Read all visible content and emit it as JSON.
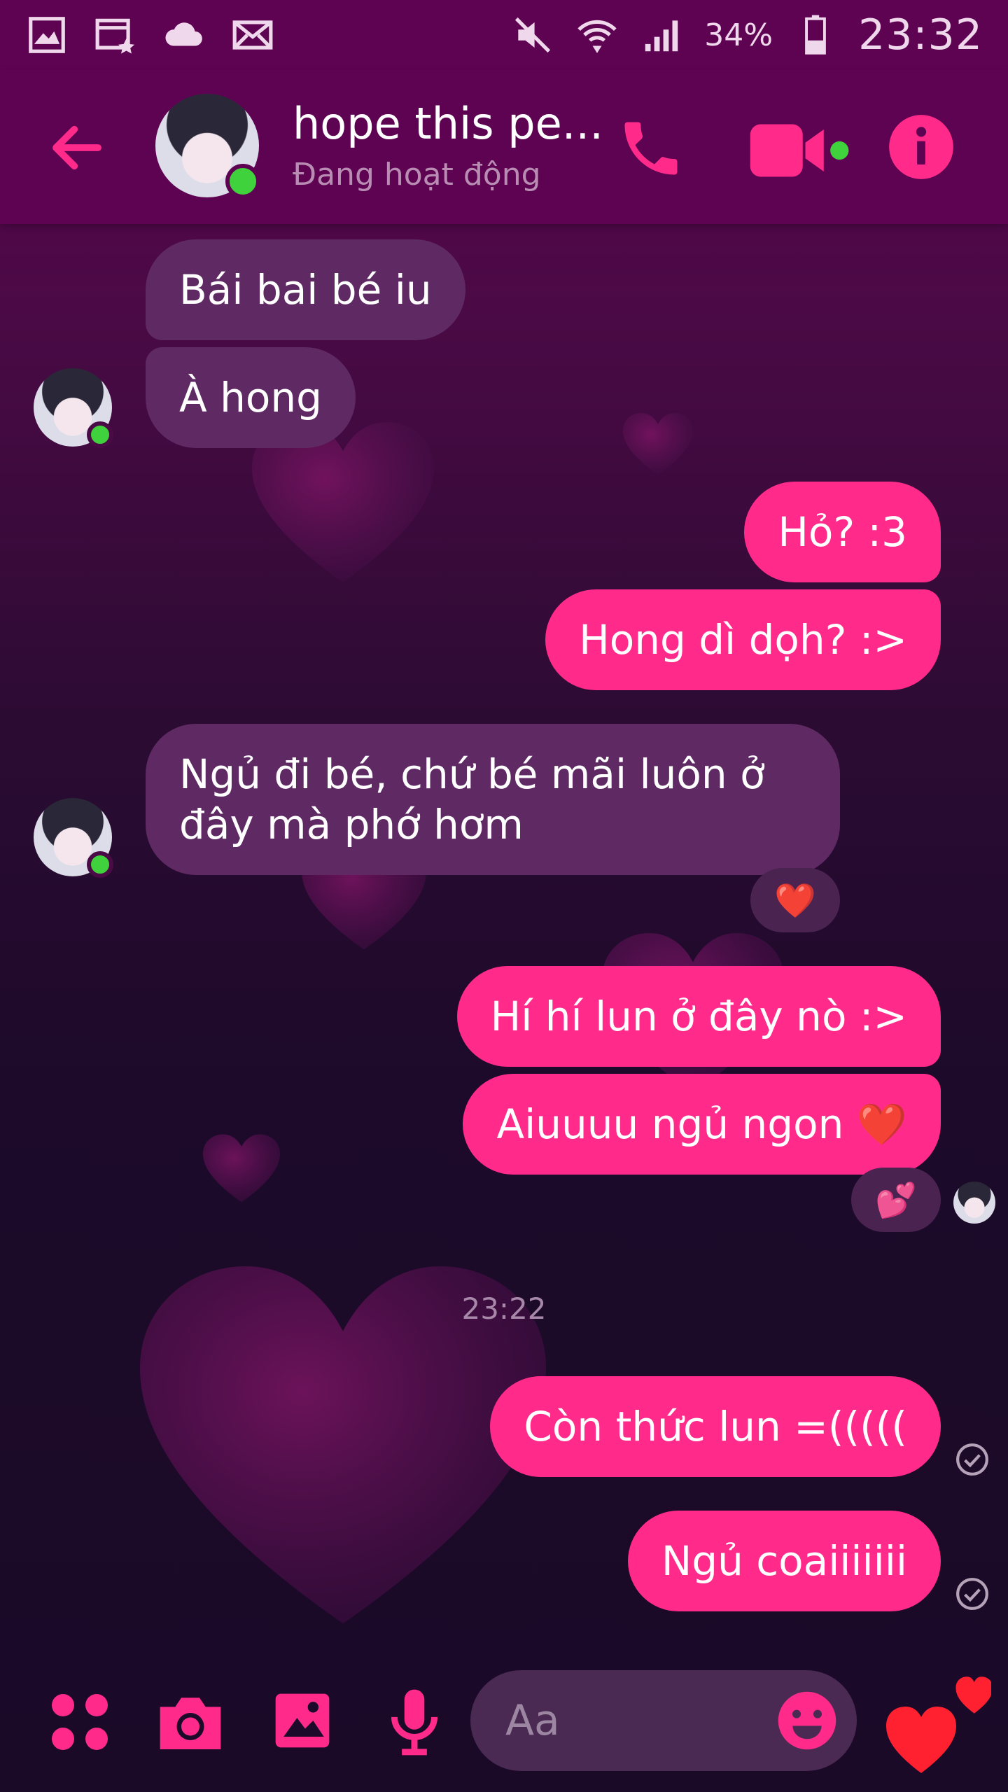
{
  "status_bar": {
    "battery_percent": "34%",
    "time": "23:32"
  },
  "header": {
    "contact_name": "hope this pe...",
    "status": "Đang hoạt động"
  },
  "messages": [
    {
      "side": "in",
      "text": "Bái bai bé iu"
    },
    {
      "side": "in",
      "text": "À hong"
    },
    {
      "side": "out",
      "text": "Hỏ? :3"
    },
    {
      "side": "out",
      "text": "Hong dì dọh? :>"
    },
    {
      "side": "in",
      "line1": "Ngủ đi bé, chứ bé mãi luôn ở",
      "line2": "đây mà phớ hơm"
    },
    {
      "side": "out",
      "text": "Hí hí lun ở đây nò :>"
    },
    {
      "side": "out",
      "text": "Aiuuuu ngủ ngon ❤️"
    },
    {
      "side": "out",
      "text": "Còn thức lun =((((("
    },
    {
      "side": "out",
      "text": "Ngủ coaiiiiiii"
    }
  ],
  "reactions": {
    "heart": "❤️",
    "two_hearts": "💕"
  },
  "timestamp": "23:22",
  "composer": {
    "placeholder": "Aa"
  },
  "colors": {
    "accent": "#ff2a8a",
    "incoming_bubble": "#5f2a64",
    "header_bg": "#5e0352"
  },
  "icons": {
    "status_left": [
      "gallery-icon",
      "calendar-icon",
      "cloud-icon",
      "mail-icon"
    ],
    "status_right": [
      "mute-icon",
      "wifi-icon",
      "signal-icon",
      "battery-icon"
    ],
    "header": [
      "back-arrow-icon",
      "phone-icon",
      "video-icon",
      "info-icon"
    ],
    "composer": [
      "apps-icon",
      "camera-icon",
      "image-icon",
      "mic-icon",
      "emoji-icon",
      "heart-like-icon"
    ]
  }
}
